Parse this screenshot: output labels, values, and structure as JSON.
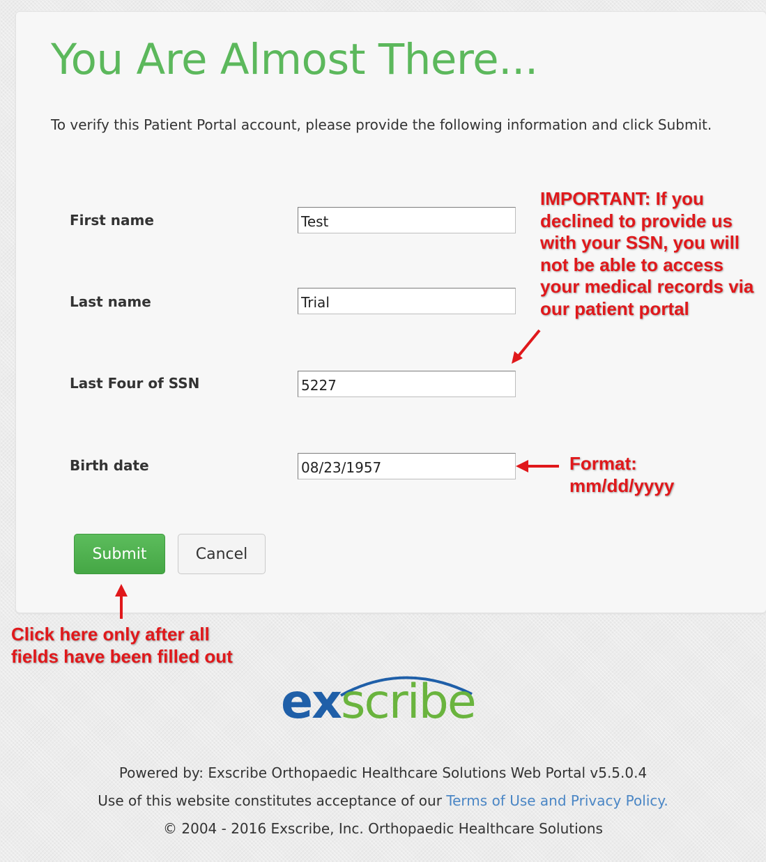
{
  "title": "You Are Almost There...",
  "intro": "To verify this Patient Portal account, please provide the following information and click Submit.",
  "form": {
    "first_name": {
      "label": "First name",
      "value": "Test"
    },
    "last_name": {
      "label": "Last name",
      "value": "Trial"
    },
    "ssn_last_four": {
      "label": "Last Four of SSN",
      "value": "5227"
    },
    "birth_date": {
      "label": "Birth date",
      "value": "08/23/1957"
    },
    "submit_label": "Submit",
    "cancel_label": "Cancel"
  },
  "annotations": {
    "important_note": "IMPORTANT:  If you declined to provide us with your SSN, you will not be able to access your medical records via our patient portal",
    "format_note": "Format: mm/dd/yyyy",
    "submit_note": "Click here only after all fields have been filled out",
    "color": "#e0181b"
  },
  "logo": {
    "prefix": "ex",
    "suffix": "scribe",
    "prefix_color": "#1f5fa8",
    "suffix_color": "#6ab43e"
  },
  "footer": {
    "powered_by": "Powered by: Exscribe Orthopaedic Healthcare Solutions Web Portal v5.5.0.4",
    "usage_prefix": "Use of this website constitutes acceptance of our ",
    "usage_link": "Terms of Use and Privacy Policy.",
    "copyright": "© 2004 - 2016 Exscribe, Inc. Orthopaedic Healthcare Solutions"
  },
  "colors": {
    "title_green": "#5cb85c",
    "submit_green": "#4cae4c",
    "link_blue": "#4a86c5"
  }
}
